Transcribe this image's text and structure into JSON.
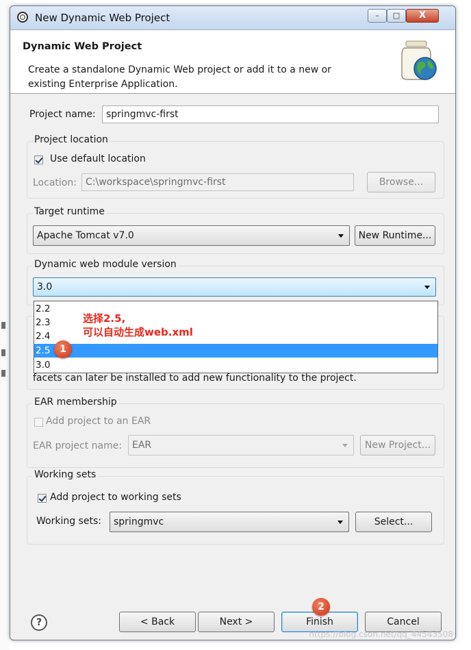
{
  "window": {
    "title": "New Dynamic Web Project",
    "controls": {
      "minimize": "–",
      "maximize": "□",
      "close": "X"
    }
  },
  "banner": {
    "title": "Dynamic Web Project",
    "description": "Create a standalone Dynamic Web project or add it to a new or existing Enterprise Application.",
    "icon": "jar-globe-icon"
  },
  "project_name": {
    "label": "Project name:",
    "value": "springmvc-first"
  },
  "project_location": {
    "group_title": "Project location",
    "use_default_label": "Use default location",
    "use_default_checked": true,
    "location_label": "Location:",
    "location_value": "C:\\workspace\\springmvc-first",
    "browse_label": "Browse..."
  },
  "target_runtime": {
    "group_title": "Target runtime",
    "selected": "Apache Tomcat v7.0",
    "new_runtime_label": "New Runtime..."
  },
  "module_version": {
    "group_title": "Dynamic web module version",
    "selected": "3.0",
    "options": [
      "2.2",
      "2.3",
      "2.4",
      "2.5",
      "3.0"
    ],
    "highlighted_option": "2.5"
  },
  "configuration": {
    "partial_text": "facets can later be installed to add new functionality to the project."
  },
  "annotation": {
    "line1": "选择2.5,",
    "line2": "可以自动生成web.xml",
    "badge1": "1",
    "badge2": "2",
    "color": "#e8281b"
  },
  "ear_membership": {
    "group_title": "EAR membership",
    "add_label": "Add project to an EAR",
    "add_checked": false,
    "ear_name_label": "EAR project name:",
    "ear_name_value": "EAR",
    "new_project_label": "New Project..."
  },
  "working_sets": {
    "group_title": "Working sets",
    "add_label": "Add project to working sets",
    "add_checked": true,
    "sets_label": "Working sets:",
    "sets_value": "springmvc",
    "select_label": "Select..."
  },
  "footer": {
    "help_symbol": "?",
    "back_label": "< Back",
    "next_label": "Next >",
    "finish_label": "Finish",
    "cancel_label": "Cancel"
  },
  "watermark": "https://blog.csdn.net/qq_44543508"
}
